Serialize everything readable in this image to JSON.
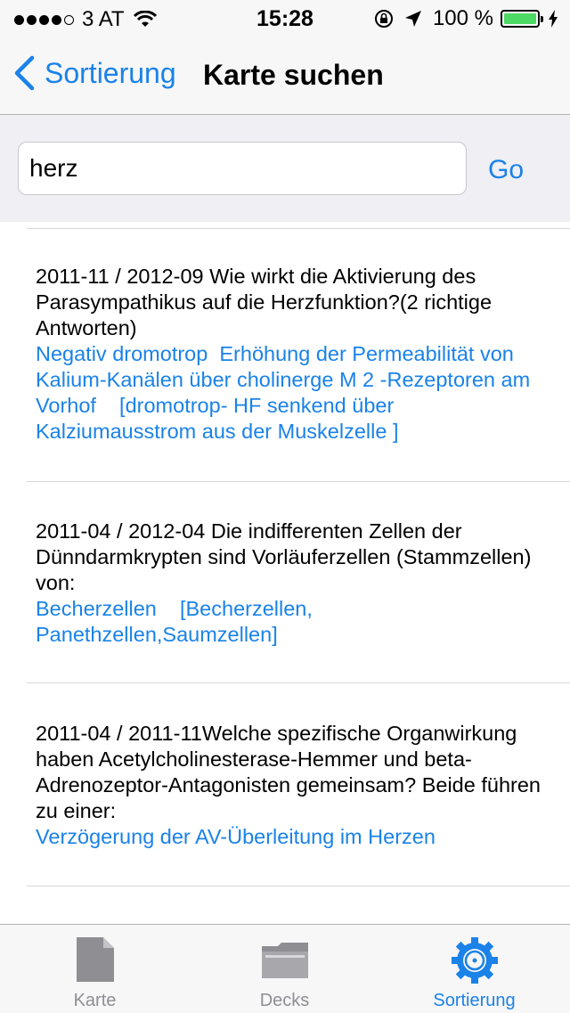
{
  "status_bar": {
    "carrier": "3 AT",
    "time": "15:28",
    "battery": "100 %"
  },
  "nav": {
    "back_label": "Sortierung",
    "title": "Karte suchen"
  },
  "search": {
    "value": "herz",
    "go_label": "Go"
  },
  "results": [
    {
      "question": "2011-11 / 2012-09 Wie wirkt die Aktivierung des Parasympathikus auf die Herzfunktion?(2 richtige Antworten)",
      "answer": "Negativ dromotrop  Erhöhung der Permeabilität von Kalium-Kanälen über cholinerge M 2 -Rezeptoren am Vorhof    [dromotrop- HF senkend über Kalziumausstrom aus der Muskelzelle ]"
    },
    {
      "question": "2011-04 / 2012-04 Die indifferenten Zellen der Dünndarmkrypten sind Vorläuferzellen (Stammzellen) von:",
      "answer": "Becherzellen    [Becherzellen, Panethzellen,Saumzellen]"
    },
    {
      "question": "2011-04 / 2011-11Welche spezifische Organwirkung haben Acetylcholinesterase-Hemmer und beta-Adrenozeptor-Antagonisten gemeinsam? Beide führen zu einer:",
      "answer": "Verzögerung der AV-Überleitung im Herzen"
    }
  ],
  "tabs": [
    {
      "label": "Karte",
      "icon": "card-icon",
      "active": false
    },
    {
      "label": "Decks",
      "icon": "folder-icon",
      "active": false
    },
    {
      "label": "Sortierung",
      "icon": "gear-icon",
      "active": true
    }
  ],
  "colors": {
    "accent": "#1a82e8",
    "battery": "#4cd964",
    "inactive": "#8e8e93"
  }
}
